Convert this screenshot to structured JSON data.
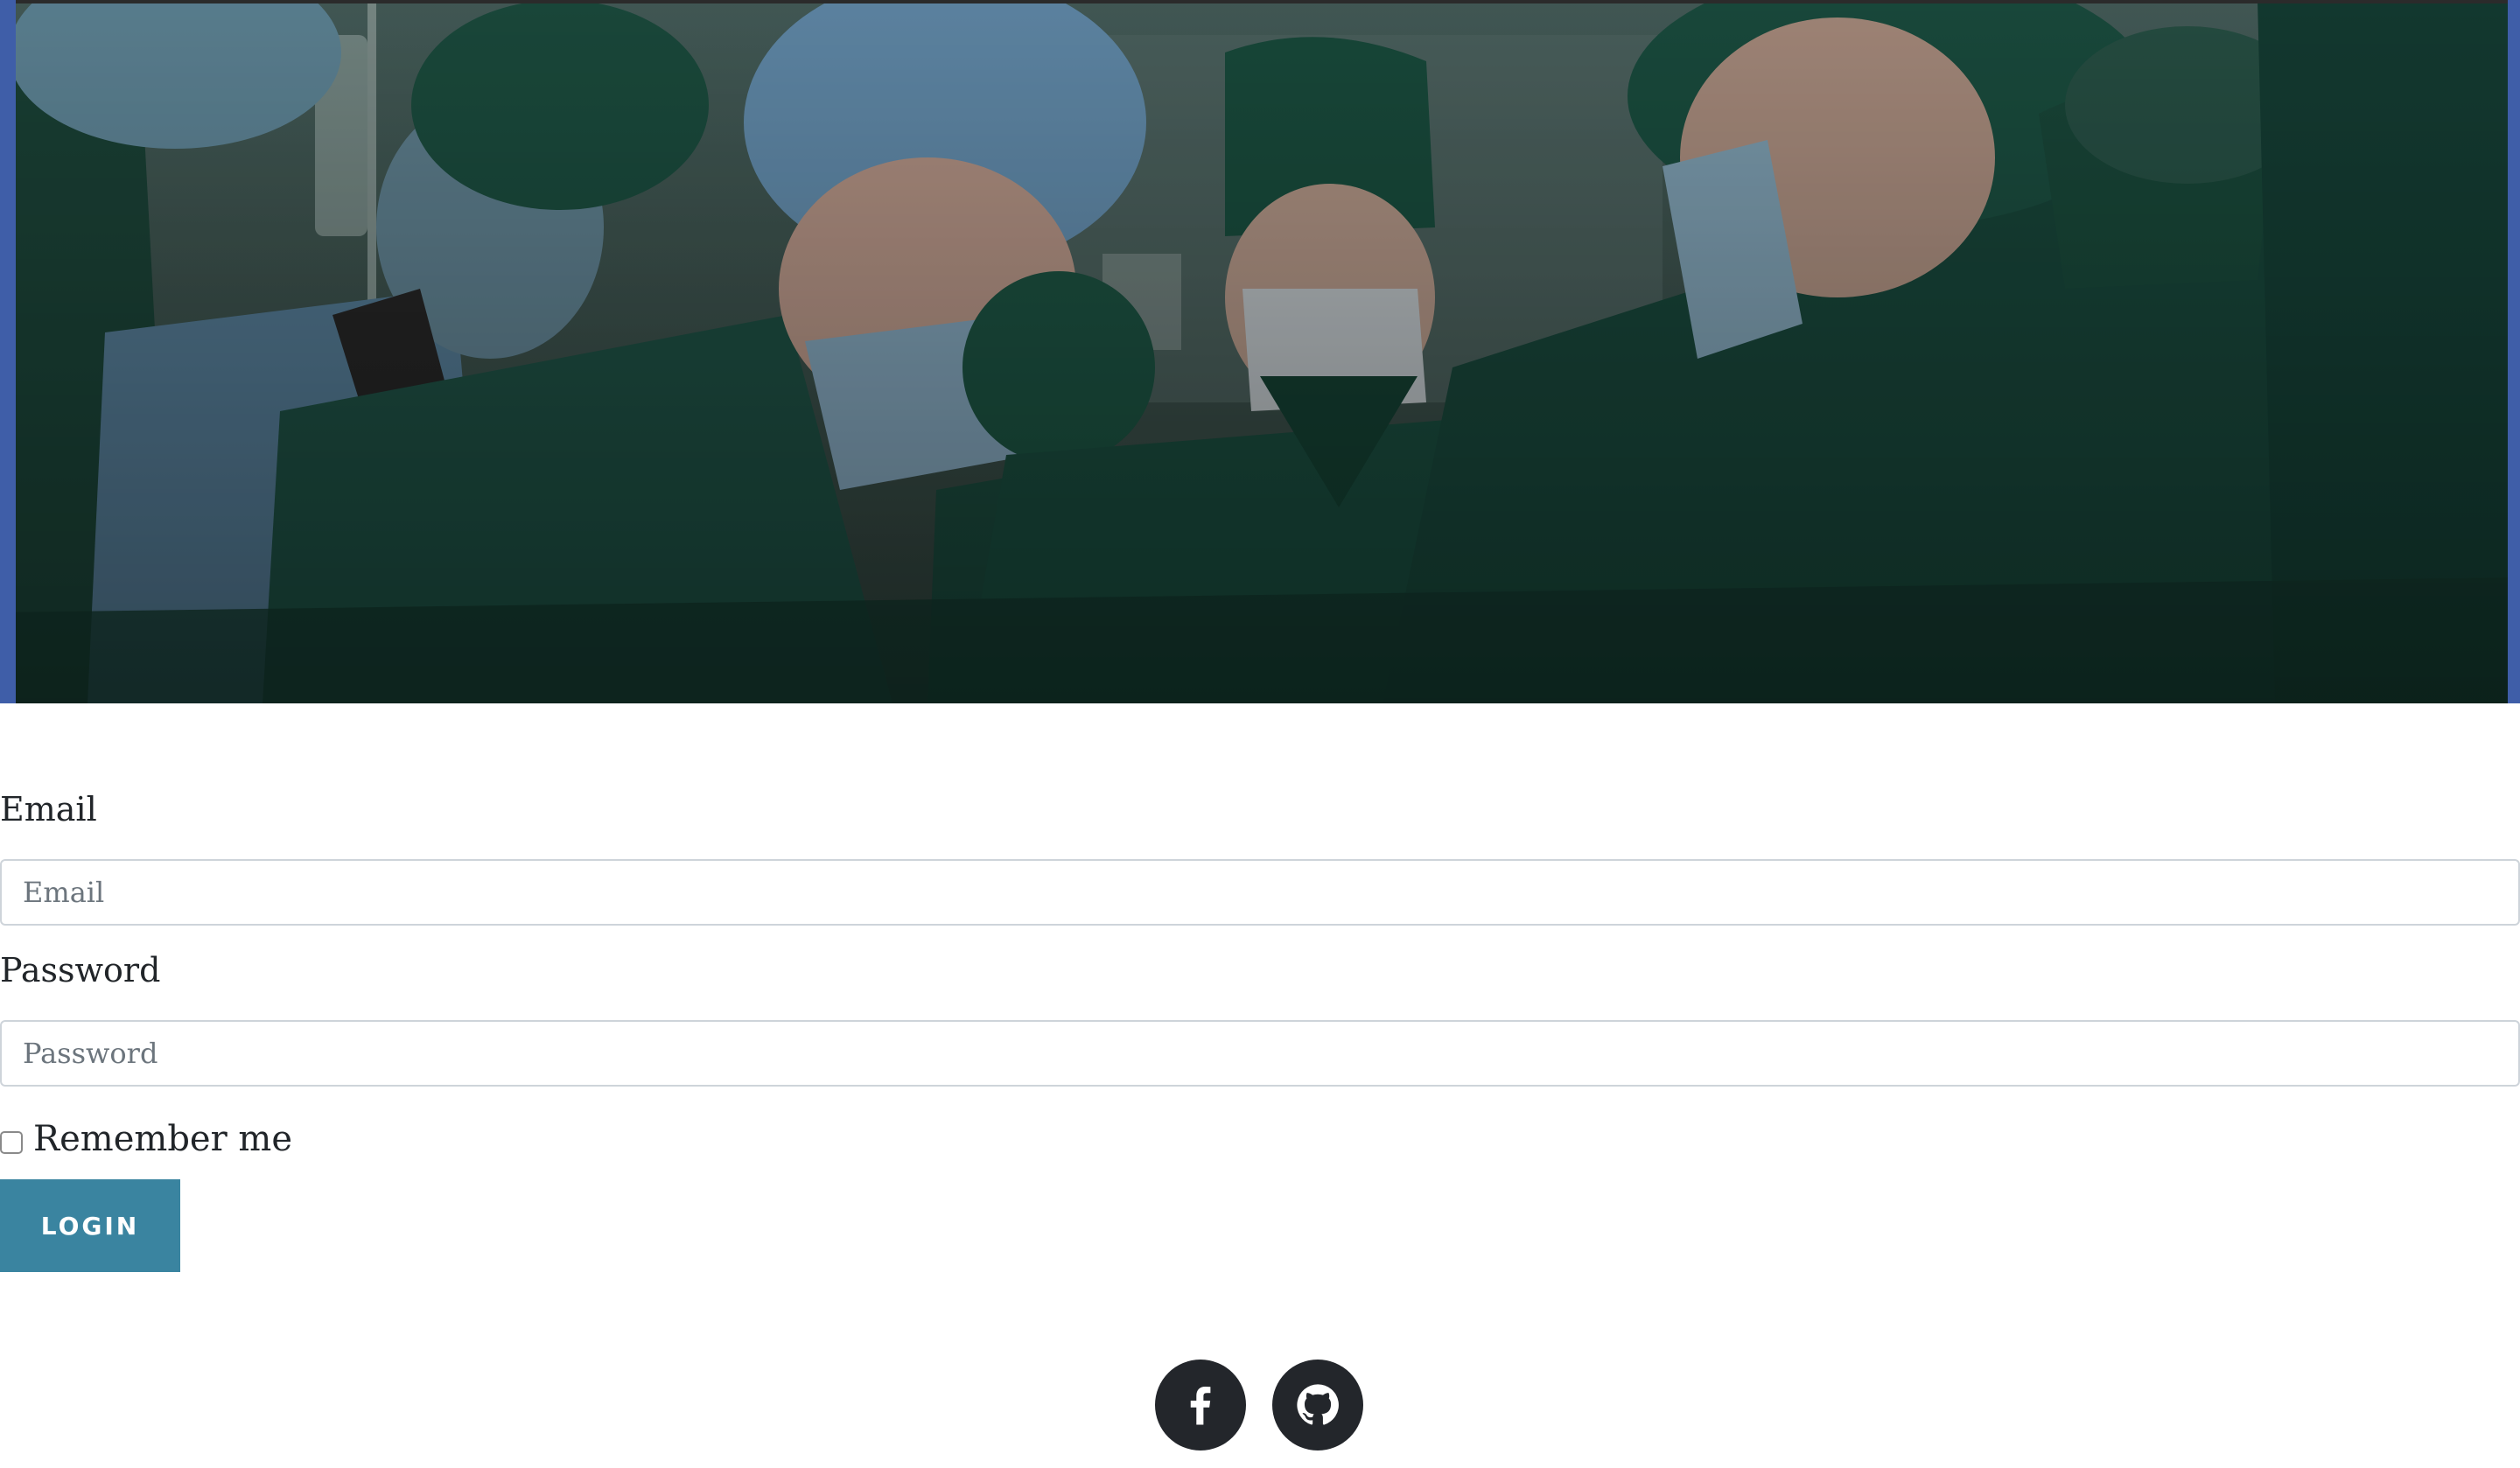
{
  "hero": {
    "image_alt": "surgeons-operating-room-photo"
  },
  "form": {
    "email_label": "Email",
    "email_placeholder": "Email",
    "email_value": "",
    "password_label": "Password",
    "password_placeholder": "Password",
    "password_value": "",
    "remember_label": "Remember me",
    "remember_checked": false,
    "login_label": "LOGIN"
  },
  "social": {
    "items": [
      {
        "name": "facebook",
        "icon": "facebook-icon"
      },
      {
        "name": "github",
        "icon": "github-icon"
      }
    ]
  },
  "colors": {
    "accent": "#3a84a0",
    "social_bg": "#23262b",
    "input_border": "#ced4da",
    "hero_edge": "#3f5ea8"
  }
}
